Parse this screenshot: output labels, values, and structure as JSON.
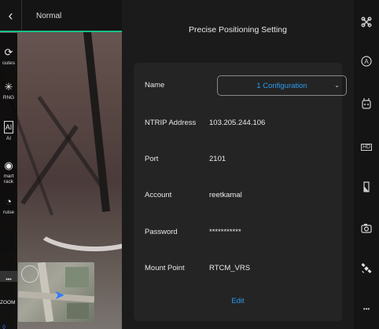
{
  "topbar": {
    "back_icon": "chevron-left-icon",
    "mode_label": "Normal"
  },
  "left_tools": [
    {
      "id": "routes",
      "icon": "route-icon",
      "label": "outes"
    },
    {
      "id": "rng",
      "icon": "rng-icon",
      "label": "RNG"
    },
    {
      "id": "ai",
      "icon": "ai-icon",
      "label": "AI"
    },
    {
      "id": "smart-track",
      "icon": "target-icon",
      "label": "mart\nrack"
    },
    {
      "id": "cruise",
      "icon": "speedometer-icon",
      "label": "ruise"
    }
  ],
  "left_more_label": "•••",
  "zoom_label": "ZOOM",
  "panel": {
    "title": "Precise Positioning Setting",
    "fields": {
      "name_label": "Name",
      "name_value": "1 Configuration",
      "ntrip_label": "NTRIP Address",
      "ntrip_value": "103.205.244.106",
      "port_label": "Port",
      "port_value": "2101",
      "account_label": "Account",
      "account_value": "reetkamal",
      "password_label": "Password",
      "password_value": "***********",
      "mount_label": "Mount Point",
      "mount_value": "RTCM_VRS"
    },
    "edit_label": "Edit"
  },
  "right_rail": [
    {
      "id": "drone",
      "icon": "drone-icon"
    },
    {
      "id": "auto",
      "icon": "auto-a-icon"
    },
    {
      "id": "remote",
      "icon": "remote-controller-icon"
    },
    {
      "id": "hd",
      "icon": "hd-icon",
      "label": "HD"
    },
    {
      "id": "battery",
      "icon": "battery-icon"
    },
    {
      "id": "camera",
      "icon": "camera-icon"
    },
    {
      "id": "satellite",
      "icon": "satellite-icon"
    },
    {
      "id": "more",
      "icon": "more-dots-icon",
      "label": "•••"
    }
  ],
  "colors": {
    "accent_blue": "#2b9cf2",
    "accent_green": "#18c08a",
    "panel_bg": "#1b1b1b",
    "card_bg": "#242424"
  }
}
